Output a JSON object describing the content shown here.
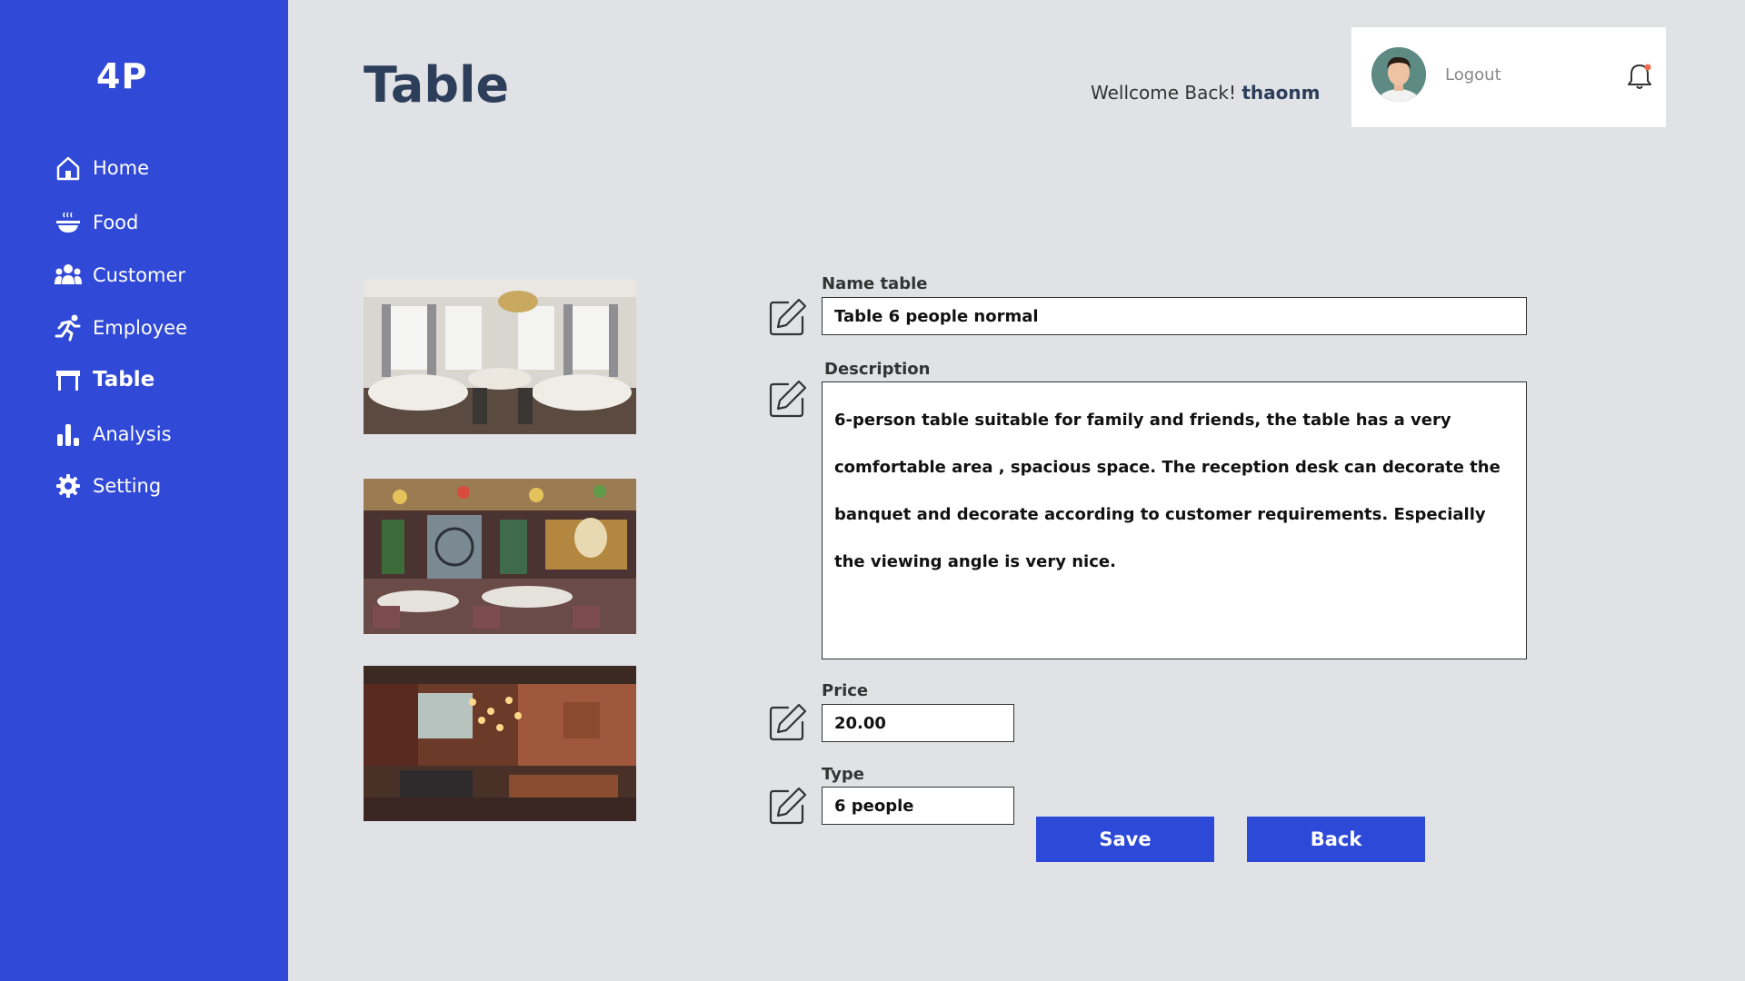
{
  "sidebar": {
    "logo": "4P",
    "items": [
      {
        "label": "Home",
        "icon": "home-icon"
      },
      {
        "label": "Food",
        "icon": "food-bowl-icon"
      },
      {
        "label": "Customer",
        "icon": "users-icon"
      },
      {
        "label": "Employee",
        "icon": "running-person-icon"
      },
      {
        "label": "Table",
        "icon": "table-icon",
        "active": true
      },
      {
        "label": "Analysis",
        "icon": "bar-chart-icon"
      },
      {
        "label": "Setting",
        "icon": "gear-icon"
      }
    ]
  },
  "header": {
    "title": "Table",
    "welcome_text": "Wellcome Back!",
    "username": "thaonm",
    "logout_label": "Logout"
  },
  "form": {
    "name": {
      "label": "Name table",
      "value": "Table 6 people normal"
    },
    "description": {
      "label": "Description",
      "value": "6-person table suitable for family and friends,  the table has a very comfortable area ,  spacious  space.  The   reception  desk   can decorate   the banquet  and decorate according to  customer  requirements. Especially the  viewing angle is very nice."
    },
    "price": {
      "label": "Price",
      "value": "20.00"
    },
    "type": {
      "label": "Type",
      "value": "6 people"
    },
    "save_label": "Save",
    "back_label": "Back"
  },
  "colors": {
    "sidebar": "#3049d6",
    "background": "#e1e2e5",
    "button": "#2d49d8",
    "title": "#2c3e5a",
    "notification_dot": "#f26b4f"
  }
}
